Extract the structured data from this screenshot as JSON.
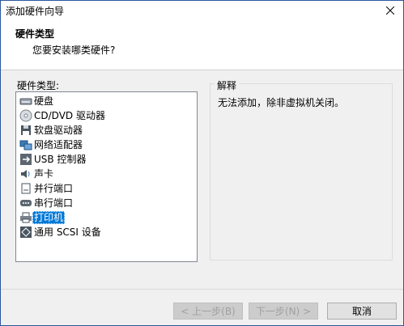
{
  "window": {
    "title": "添加硬件向导"
  },
  "header": {
    "title": "硬件类型",
    "subtitle": "您要安装哪类硬件?"
  },
  "hardware_list": {
    "label": "硬件类型:",
    "selected_index": 8,
    "items": [
      {
        "label": "硬盘",
        "icon": "hard-disk-icon"
      },
      {
        "label": "CD/DVD 驱动器",
        "icon": "cd-dvd-icon"
      },
      {
        "label": "软盘驱动器",
        "icon": "floppy-icon"
      },
      {
        "label": "网络适配器",
        "icon": "network-adapter-icon"
      },
      {
        "label": "USB 控制器",
        "icon": "usb-icon"
      },
      {
        "label": "声卡",
        "icon": "sound-card-icon"
      },
      {
        "label": "并行端口",
        "icon": "parallel-port-icon"
      },
      {
        "label": "串行端口",
        "icon": "serial-port-icon"
      },
      {
        "label": "打印机",
        "icon": "printer-icon"
      },
      {
        "label": "通用 SCSI 设备",
        "icon": "scsi-icon"
      }
    ]
  },
  "explanation": {
    "title": "解释",
    "text": "无法添加，除非虚拟机关闭。"
  },
  "buttons": {
    "back": "< 上一步(B)",
    "next": "下一步(N) >",
    "cancel": "取消"
  },
  "colors": {
    "selection": "#0078d7",
    "window_border": "#2b579a"
  }
}
